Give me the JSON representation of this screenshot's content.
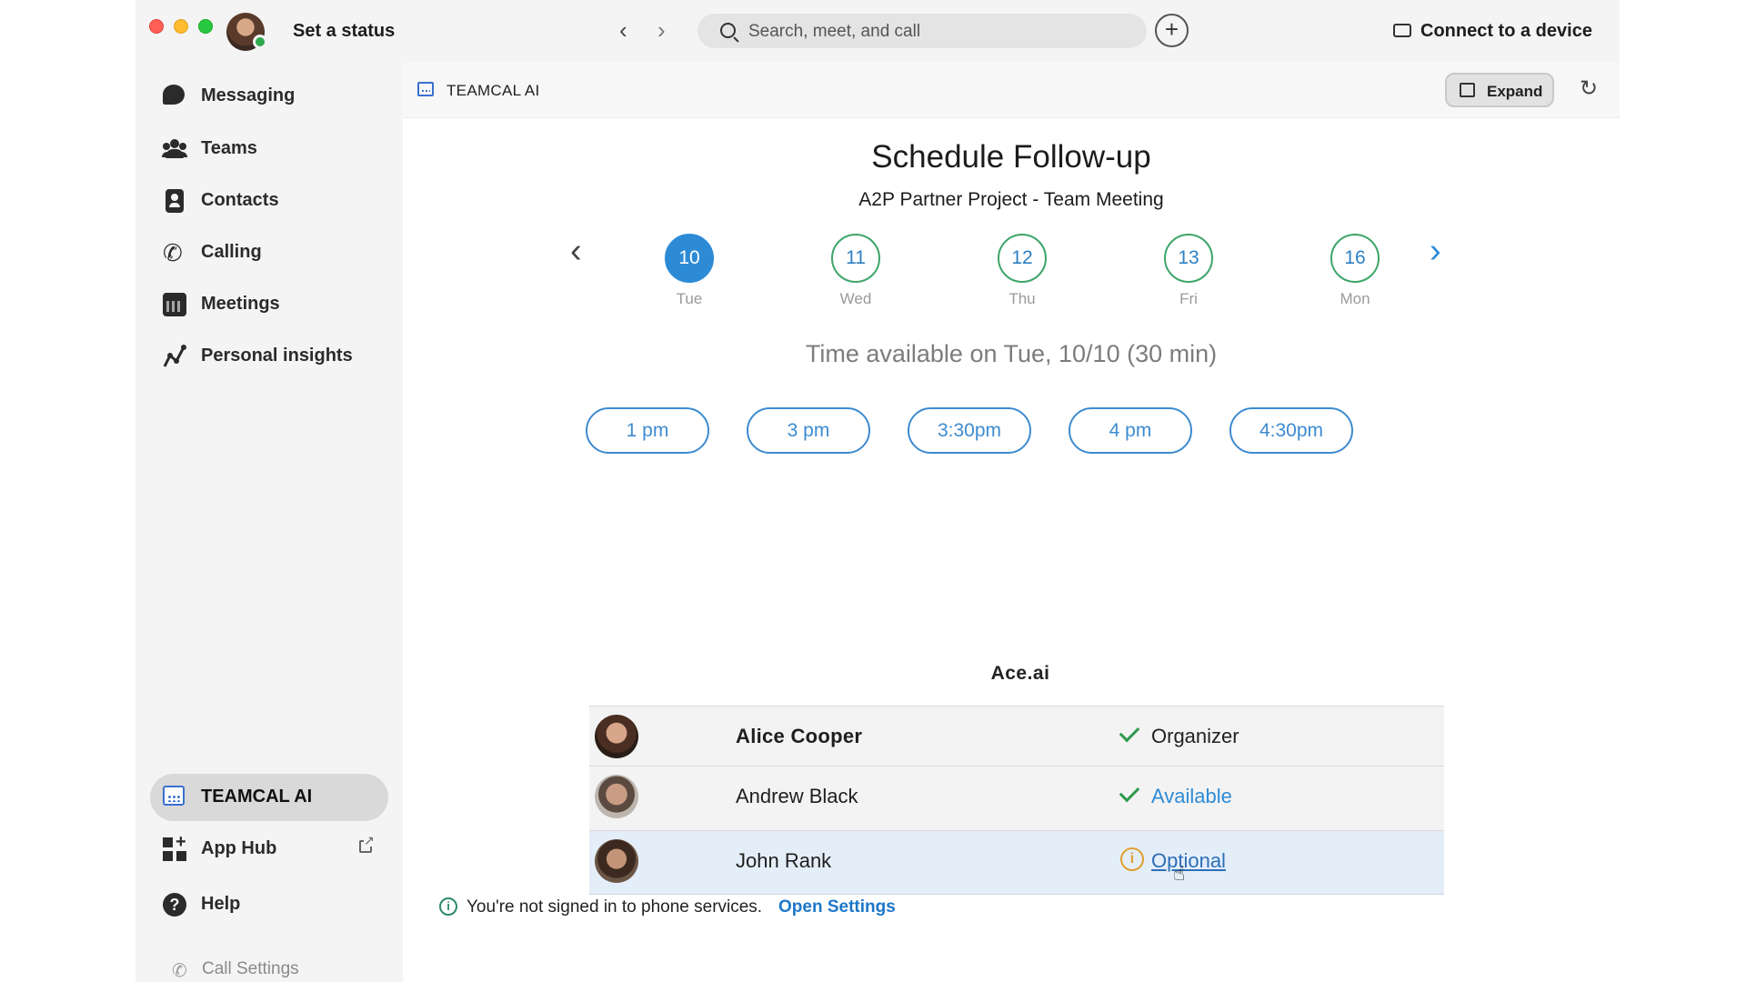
{
  "titlebar": {
    "status_label": "Set a status",
    "search_placeholder": "Search, meet, and call",
    "connect_label": "Connect to a device"
  },
  "sidebar": {
    "items": [
      {
        "label": "Messaging",
        "icon": "message-bubble-icon"
      },
      {
        "label": "Teams",
        "icon": "people-icon"
      },
      {
        "label": "Contacts",
        "icon": "contact-card-icon"
      },
      {
        "label": "Calling",
        "icon": "phone-icon"
      },
      {
        "label": "Meetings",
        "icon": "calendar-icon"
      },
      {
        "label": "Personal insights",
        "icon": "insights-icon"
      }
    ],
    "apps": [
      {
        "label": "TEAMCAL AI",
        "icon": "teamcal-icon",
        "active": true
      },
      {
        "label": "App Hub",
        "icon": "app-hub-icon"
      },
      {
        "label": "Help",
        "icon": "help-icon"
      }
    ],
    "call_settings": "Call Settings"
  },
  "main": {
    "header_title": "TEAMCAL AI",
    "expand_label": "Expand",
    "title": "Schedule Follow-up",
    "subtitle": "A2P Partner Project - Team Meeting",
    "dates": [
      {
        "num": "10",
        "day": "Tue",
        "selected": true
      },
      {
        "num": "11",
        "day": "Wed"
      },
      {
        "num": "12",
        "day": "Thu"
      },
      {
        "num": "13",
        "day": "Fri"
      },
      {
        "num": "16",
        "day": "Mon"
      }
    ],
    "availability_text": "Time available on Tue, 10/10 (30 min)",
    "time_slots": [
      "1 pm",
      "3 pm",
      "3:30pm",
      "4 pm",
      "4:30pm"
    ],
    "organization": "Ace.ai",
    "attendees": [
      {
        "name": "Alice Cooper",
        "status": "Organizer"
      },
      {
        "name": "Andrew Black",
        "status": "Available"
      },
      {
        "name": "John Rank",
        "status": "Optional"
      }
    ],
    "footer_message": "You're not signed in to phone services.",
    "footer_link": "Open Settings"
  },
  "colors": {
    "accent": "#2d8bd6",
    "available_check": "#2e9a4f",
    "optional_warning": "#e0a030",
    "date_ring": "#3da56a"
  }
}
